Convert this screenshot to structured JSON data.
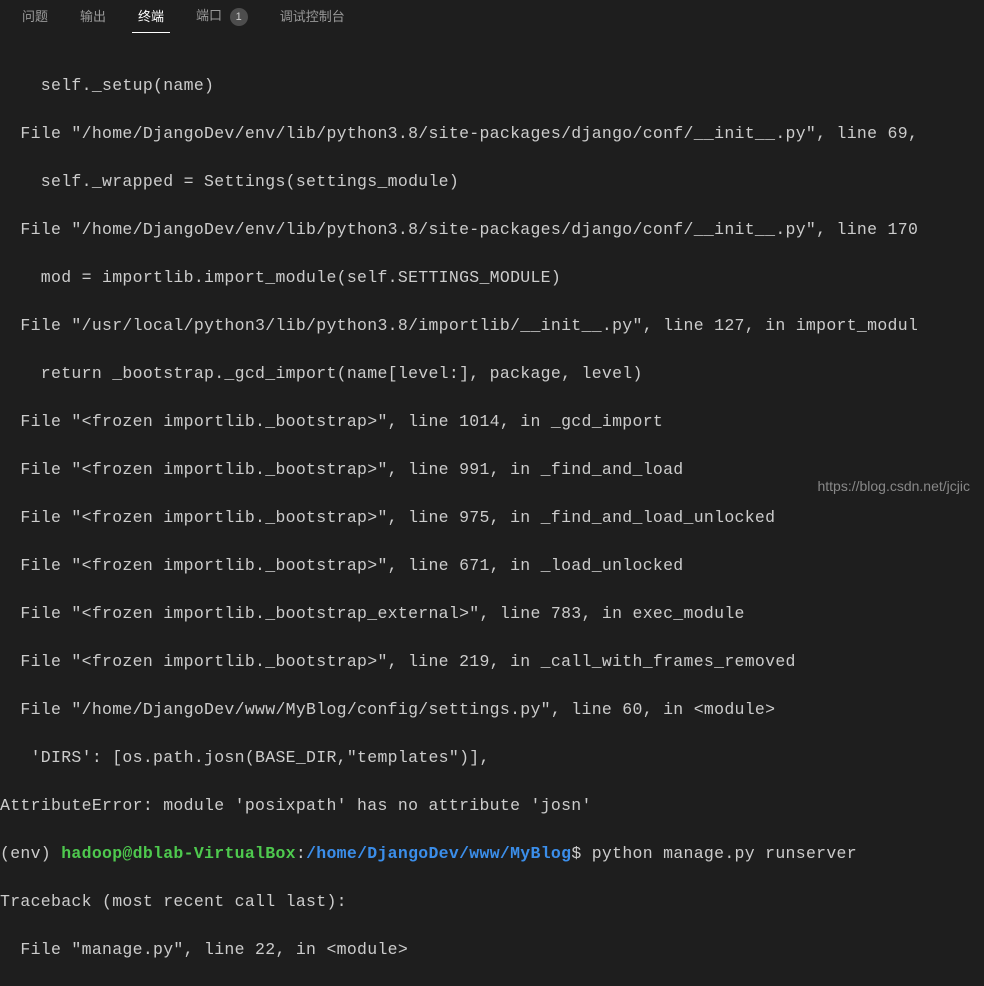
{
  "tabs": {
    "problems": "问题",
    "output": "输出",
    "terminal": "终端",
    "ports": "端口",
    "ports_badge": "1",
    "debug_console": "调试控制台"
  },
  "terminal": {
    "lines": [
      "    self._setup(name)",
      "  File \"/home/DjangoDev/env/lib/python3.8/site-packages/django/conf/__init__.py\", line 69,",
      "    self._wrapped = Settings(settings_module)",
      "  File \"/home/DjangoDev/env/lib/python3.8/site-packages/django/conf/__init__.py\", line 170",
      "    mod = importlib.import_module(self.SETTINGS_MODULE)",
      "  File \"/usr/local/python3/lib/python3.8/importlib/__init__.py\", line 127, in import_modul",
      "    return _bootstrap._gcd_import(name[level:], package, level)",
      "  File \"<frozen importlib._bootstrap>\", line 1014, in _gcd_import",
      "  File \"<frozen importlib._bootstrap>\", line 991, in _find_and_load",
      "  File \"<frozen importlib._bootstrap>\", line 975, in _find_and_load_unlocked",
      "  File \"<frozen importlib._bootstrap>\", line 671, in _load_unlocked",
      "  File \"<frozen importlib._bootstrap_external>\", line 783, in exec_module",
      "  File \"<frozen importlib._bootstrap>\", line 219, in _call_with_frames_removed",
      "  File \"/home/DjangoDev/www/MyBlog/config/settings.py\", line 60, in <module>",
      "   'DIRS': [os.path.josn(BASE_DIR,\"templates\")],",
      "AttributeError: module 'posixpath' has no attribute 'josn'"
    ],
    "prompt": {
      "env": "(env) ",
      "user_host": "hadoop@dblab-VirtualBox",
      "sep": ":",
      "path": "/home/DjangoDev/www/MyBlog",
      "dollar": "$ ",
      "command": "python manage.py runserver"
    },
    "after": [
      "Traceback (most recent call last):",
      "  File \"manage.py\", line 22, in <module>"
    ]
  },
  "watermark": "https://blog.csdn.net/jcjic"
}
